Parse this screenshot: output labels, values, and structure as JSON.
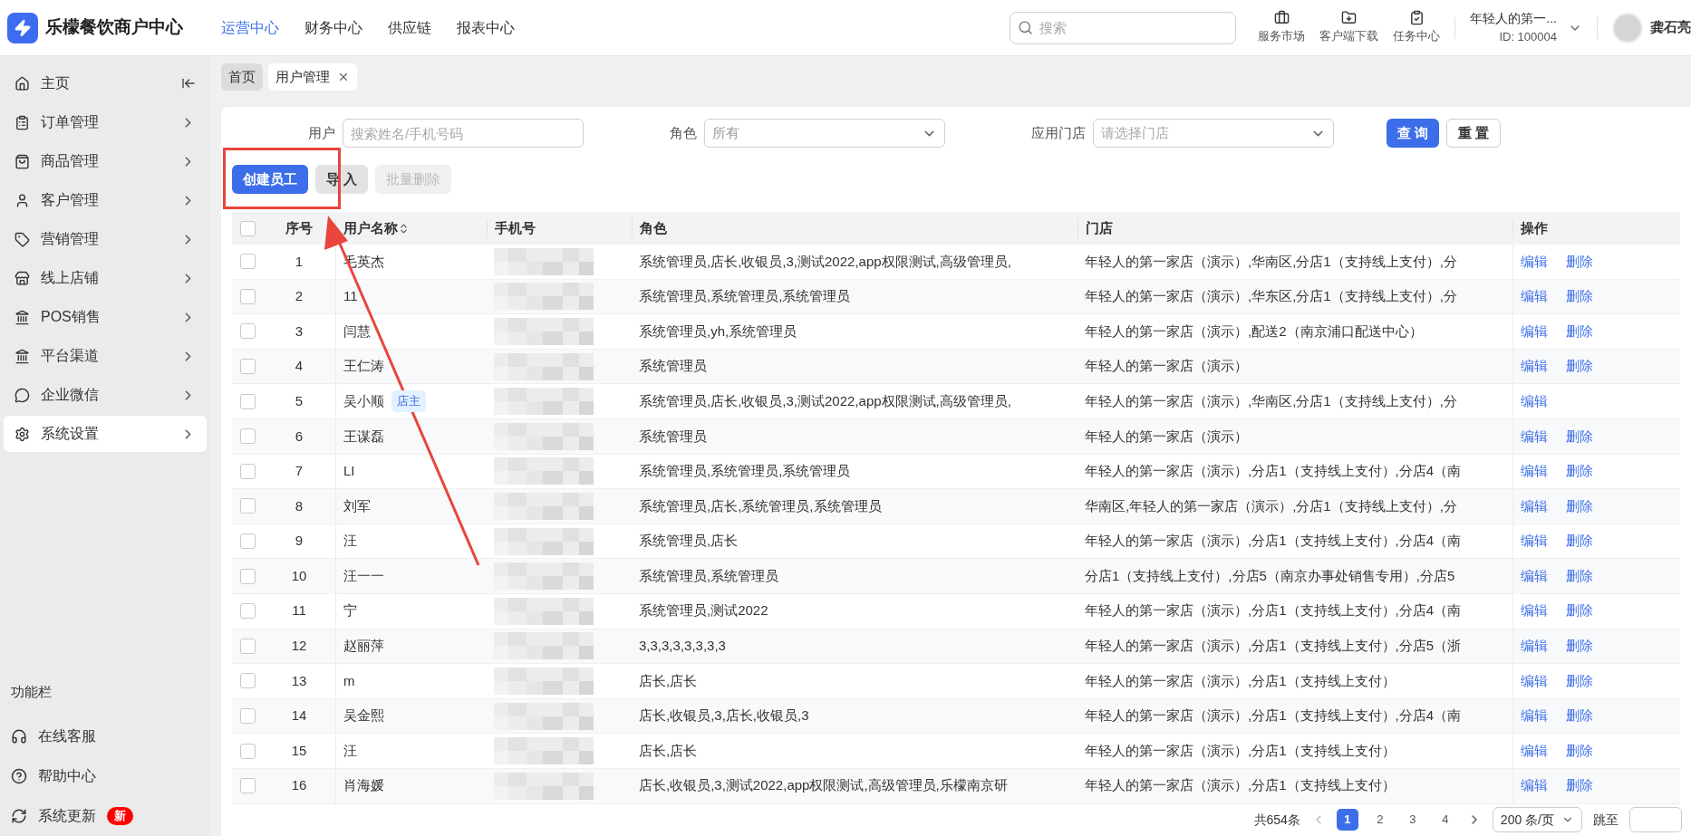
{
  "header": {
    "brand": "乐檬餐饮商户中心",
    "nav": [
      {
        "label": "运营中心",
        "selected": true
      },
      {
        "label": "财务中心",
        "selected": false
      },
      {
        "label": "供应链",
        "selected": false
      },
      {
        "label": "报表中心",
        "selected": false
      }
    ],
    "search": {
      "placeholder": "搜索"
    },
    "tools": [
      "服务市场",
      "客户端下载",
      "任务中心"
    ],
    "account": {
      "name": "年轻人的第一...",
      "id": "ID: 100004"
    },
    "user": "龚石亮"
  },
  "sidebar": {
    "items": [
      {
        "label": "主页",
        "selected": false
      },
      {
        "label": "订单管理",
        "selected": false
      },
      {
        "label": "商品管理",
        "selected": false
      },
      {
        "label": "客户管理",
        "selected": false
      },
      {
        "label": "营销管理",
        "selected": false
      },
      {
        "label": "线上店铺",
        "selected": false
      },
      {
        "label": "POS销售",
        "selected": false
      },
      {
        "label": "平台渠道",
        "selected": false
      },
      {
        "label": "企业微信",
        "selected": false
      },
      {
        "label": "系统设置",
        "selected": true
      }
    ],
    "footer_title": "功能栏",
    "footer_items": [
      {
        "label": "在线客服"
      },
      {
        "label": "帮助中心"
      },
      {
        "label": "系统更新",
        "badge": "新"
      }
    ]
  },
  "tabs": [
    {
      "label": "首页",
      "selected": false,
      "closable": false
    },
    {
      "label": "用户管理",
      "selected": true,
      "closable": true
    }
  ],
  "filters": [
    {
      "label": "用户",
      "placeholder": "搜索姓名/手机号码",
      "kind": "text"
    },
    {
      "label": "角色",
      "value": "所有",
      "kind": "select"
    },
    {
      "label": "应用门店",
      "placeholder": "请选择门店",
      "kind": "select"
    }
  ],
  "filter_buttons": [
    {
      "label": "查 询",
      "primary": true
    },
    {
      "label": "重 置",
      "primary": false
    }
  ],
  "actions": [
    {
      "label": "创建员工",
      "primary": true,
      "disabled": false
    },
    {
      "label": "导 入",
      "primary": false,
      "disabled": false
    },
    {
      "label": "批量删除",
      "primary": false,
      "disabled": true
    }
  ],
  "table": {
    "all_checked": false,
    "columns": [
      {
        "label": "序号"
      },
      {
        "label": "用户名称",
        "sortable": true
      },
      {
        "label": "手机号"
      },
      {
        "label": "角色"
      },
      {
        "label": "门店"
      },
      {
        "label": "操作"
      }
    ],
    "rows": [
      {
        "no": "1",
        "name": "毛英杰",
        "checked": false,
        "role": "系统管理员,店长,收银员,3,测试2022,app权限测试,高级管理员,",
        "store": "年轻人的第一家店（演示）,华南区,分店1（支持线上支付）,分",
        "actions": [
          "编辑",
          "删除"
        ]
      },
      {
        "no": "2",
        "name": "11",
        "checked": false,
        "role": "系统管理员,系统管理员,系统管理员",
        "store": "年轻人的第一家店（演示）,华东区,分店1（支持线上支付）,分",
        "actions": [
          "编辑",
          "删除"
        ]
      },
      {
        "no": "3",
        "name": "闫慧",
        "checked": false,
        "role": "系统管理员,yh,系统管理员",
        "store": "年轻人的第一家店（演示）,配送2（南京浦口配送中心）",
        "actions": [
          "编辑",
          "删除"
        ]
      },
      {
        "no": "4",
        "name": "王仁涛",
        "checked": false,
        "role": "系统管理员",
        "store": "年轻人的第一家店（演示）",
        "actions": [
          "编辑",
          "删除"
        ]
      },
      {
        "no": "5",
        "name": "吴小顺",
        "badge": "店主",
        "checked": false,
        "role": "系统管理员,店长,收银员,3,测试2022,app权限测试,高级管理员,",
        "store": "年轻人的第一家店（演示）,华南区,分店1（支持线上支付）,分",
        "actions": [
          "编辑"
        ]
      },
      {
        "no": "6",
        "name": "王谋磊",
        "checked": false,
        "role": "系统管理员",
        "store": "年轻人的第一家店（演示）",
        "actions": [
          "编辑",
          "删除"
        ]
      },
      {
        "no": "7",
        "name": "LI",
        "checked": false,
        "role": "系统管理员,系统管理员,系统管理员",
        "store": "年轻人的第一家店（演示）,分店1（支持线上支付）,分店4（南",
        "actions": [
          "编辑",
          "删除"
        ]
      },
      {
        "no": "8",
        "name": "刘军",
        "checked": false,
        "role": "系统管理员,店长,系统管理员,系统管理员",
        "store": "华南区,年轻人的第一家店（演示）,分店1（支持线上支付）,分",
        "actions": [
          "编辑",
          "删除"
        ]
      },
      {
        "no": "9",
        "name": "汪",
        "checked": false,
        "role": "系统管理员,店长",
        "store": "年轻人的第一家店（演示）,分店1（支持线上支付）,分店4（南",
        "actions": [
          "编辑",
          "删除"
        ]
      },
      {
        "no": "10",
        "name": "汪一一",
        "checked": false,
        "role": "系统管理员,系统管理员",
        "store": "分店1（支持线上支付）,分店5（南京办事处销售专用）,分店5",
        "actions": [
          "编辑",
          "删除"
        ]
      },
      {
        "no": "11",
        "name": "宁",
        "checked": false,
        "role": "系统管理员,测试2022",
        "store": "年轻人的第一家店（演示）,分店1（支持线上支付）,分店4（南",
        "actions": [
          "编辑",
          "删除"
        ]
      },
      {
        "no": "12",
        "name": "赵丽萍",
        "checked": false,
        "role": "3,3,3,3,3,3,3,3",
        "store": "年轻人的第一家店（演示）,分店1（支持线上支付）,分店5（浙",
        "actions": [
          "编辑",
          "删除"
        ]
      },
      {
        "no": "13",
        "name": "m",
        "checked": false,
        "role": "店长,店长",
        "store": "年轻人的第一家店（演示）,分店1（支持线上支付）",
        "actions": [
          "编辑",
          "删除"
        ]
      },
      {
        "no": "14",
        "name": "吴金熙",
        "checked": false,
        "role": "店长,收银员,3,店长,收银员,3",
        "store": "年轻人的第一家店（演示）,分店1（支持线上支付）,分店4（南",
        "actions": [
          "编辑",
          "删除"
        ]
      },
      {
        "no": "15",
        "name": "汪",
        "checked": false,
        "role": "店长,店长",
        "store": "年轻人的第一家店（演示）,分店1（支持线上支付）",
        "actions": [
          "编辑",
          "删除"
        ]
      },
      {
        "no": "16",
        "name": "肖海媛",
        "checked": false,
        "role": "店长,收银员,3,测试2022,app权限测试,高级管理员,乐檬南京研",
        "store": "年轻人的第一家店（演示）,分店1（支持线上支付）",
        "actions": [
          "编辑",
          "删除"
        ]
      }
    ]
  },
  "pagination": {
    "total": "共654条",
    "pages": [
      {
        "label": "1",
        "selected": true
      },
      {
        "label": "2",
        "selected": false
      },
      {
        "label": "3",
        "selected": false
      },
      {
        "label": "4",
        "selected": false
      }
    ],
    "page_size": "200 条/页",
    "jump_label": "跳至"
  }
}
